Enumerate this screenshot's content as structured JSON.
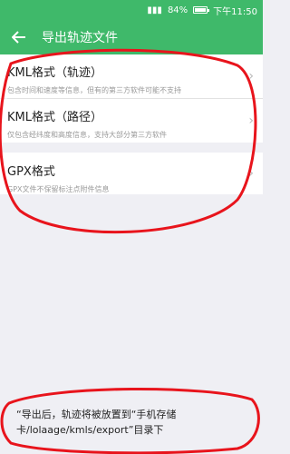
{
  "status_bar": {
    "signal_icon": "signal-icon",
    "battery_percent": "84%",
    "battery_level": 0.84,
    "time": "下午11:50"
  },
  "app_bar": {
    "back_icon": "arrow-left-icon",
    "title": "导出轨迹文件"
  },
  "options": [
    {
      "title": "KML格式（轨迹）",
      "subtitle": "包含时间和速度等信息，但有的第三方软件可能不支持"
    },
    {
      "title": "KML格式（路径）",
      "subtitle": "仅包含经纬度和高度信息，支持大部分第三方软件"
    },
    {
      "title": "GPX格式",
      "subtitle": "GPX文件不保留标注点附件信息"
    }
  ],
  "footer_note": "“导出后，轨迹将被放置到“手机存储卡/lolaage/kmls/export”目录下",
  "colors": {
    "accent": "#3fb96a",
    "annotation": "#e8141c"
  }
}
